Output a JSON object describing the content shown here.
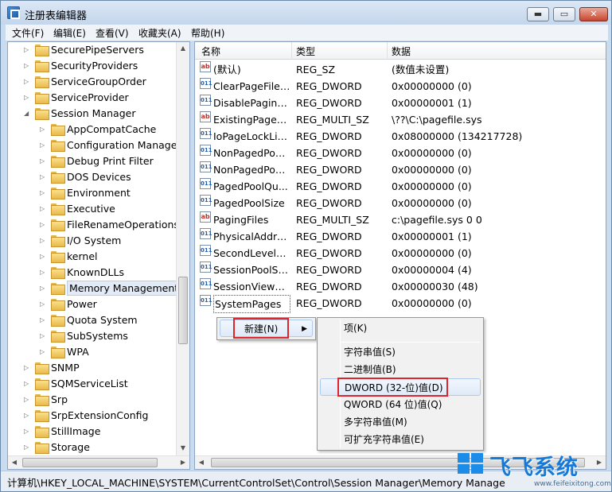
{
  "window": {
    "title": "注册表编辑器"
  },
  "controls": {
    "minimize": "▬",
    "maximize": "▭",
    "close": "✕"
  },
  "menu": [
    "文件(F)",
    "编辑(E)",
    "查看(V)",
    "收藏夹(A)",
    "帮助(H)"
  ],
  "tree": [
    {
      "label": "SecurePipeServers",
      "level": 1
    },
    {
      "label": "SecurityProviders",
      "level": 1
    },
    {
      "label": "ServiceGroupOrder",
      "level": 1
    },
    {
      "label": "ServiceProvider",
      "level": 1
    },
    {
      "label": "Session Manager",
      "level": 1,
      "expanded": true
    },
    {
      "label": "AppCompatCache",
      "level": 2
    },
    {
      "label": "Configuration Manager",
      "level": 2
    },
    {
      "label": "Debug Print Filter",
      "level": 2
    },
    {
      "label": "DOS Devices",
      "level": 2
    },
    {
      "label": "Environment",
      "level": 2
    },
    {
      "label": "Executive",
      "level": 2
    },
    {
      "label": "FileRenameOperations",
      "level": 2
    },
    {
      "label": "I/O System",
      "level": 2
    },
    {
      "label": "kernel",
      "level": 2
    },
    {
      "label": "KnownDLLs",
      "level": 2
    },
    {
      "label": "Memory Management",
      "level": 2,
      "selected": true
    },
    {
      "label": "Power",
      "level": 2
    },
    {
      "label": "Quota System",
      "level": 2
    },
    {
      "label": "SubSystems",
      "level": 2
    },
    {
      "label": "WPA",
      "level": 2
    },
    {
      "label": "SNMP",
      "level": 1
    },
    {
      "label": "SQMServiceList",
      "level": 1
    },
    {
      "label": "Srp",
      "level": 1
    },
    {
      "label": "SrpExtensionConfig",
      "level": 1
    },
    {
      "label": "StillImage",
      "level": 1
    },
    {
      "label": "Storage",
      "level": 1
    }
  ],
  "list": {
    "columns": {
      "name": "名称",
      "type": "类型",
      "data": "数据"
    },
    "rows": [
      {
        "name": "(默认)",
        "type": "REG_SZ",
        "data": "(数值未设置)",
        "icon": "ab"
      },
      {
        "name": "ClearPageFileA...",
        "type": "REG_DWORD",
        "data": "0x00000000 (0)",
        "icon": "bin"
      },
      {
        "name": "DisablePaging...",
        "type": "REG_DWORD",
        "data": "0x00000001 (1)",
        "icon": "bin"
      },
      {
        "name": "ExistingPageFil...",
        "type": "REG_MULTI_SZ",
        "data": "\\??\\C:\\pagefile.sys",
        "icon": "ab"
      },
      {
        "name": "IoPageLockLimit",
        "type": "REG_DWORD",
        "data": "0x08000000 (134217728)",
        "icon": "bin"
      },
      {
        "name": "NonPagedPoo...",
        "type": "REG_DWORD",
        "data": "0x00000000 (0)",
        "icon": "bin"
      },
      {
        "name": "NonPagedPoo...",
        "type": "REG_DWORD",
        "data": "0x00000000 (0)",
        "icon": "bin"
      },
      {
        "name": "PagedPoolQu...",
        "type": "REG_DWORD",
        "data": "0x00000000 (0)",
        "icon": "bin"
      },
      {
        "name": "PagedPoolSize",
        "type": "REG_DWORD",
        "data": "0x00000000 (0)",
        "icon": "bin"
      },
      {
        "name": "PagingFiles",
        "type": "REG_MULTI_SZ",
        "data": "c:\\pagefile.sys 0 0",
        "icon": "ab"
      },
      {
        "name": "PhysicalAddres...",
        "type": "REG_DWORD",
        "data": "0x00000001 (1)",
        "icon": "bin"
      },
      {
        "name": "SecondLevelD...",
        "type": "REG_DWORD",
        "data": "0x00000000 (0)",
        "icon": "bin"
      },
      {
        "name": "SessionPoolSize",
        "type": "REG_DWORD",
        "data": "0x00000004 (4)",
        "icon": "bin"
      },
      {
        "name": "SessionViewSize",
        "type": "REG_DWORD",
        "data": "0x00000030 (48)",
        "icon": "bin"
      },
      {
        "name": "SystemPages",
        "type": "REG_DWORD",
        "data": "0x00000000 (0)",
        "icon": "bin",
        "focused": true
      }
    ]
  },
  "context_menu": {
    "new_label": "新建(N)",
    "arrow": "▶"
  },
  "submenu": {
    "key": "项(K)",
    "string": "字符串值(S)",
    "binary": "二进制值(B)",
    "dword": "DWORD (32-位)值(D)",
    "qword": "QWORD (64 位)值(Q)",
    "multi_string": "多字符串值(M)",
    "expandable_string": "可扩充字符串值(E)"
  },
  "status": {
    "path": "计算机\\HKEY_LOCAL_MACHINE\\SYSTEM\\CurrentControlSet\\Control\\Session Manager\\Memory Manage"
  },
  "watermark": {
    "brand": "飞飞系统",
    "url": "www.feifeixitong.com"
  },
  "colors": {
    "highlight_box": "#e0242a",
    "title_bg": "#c4d6ec",
    "watermark_blue": "#1479d9"
  }
}
